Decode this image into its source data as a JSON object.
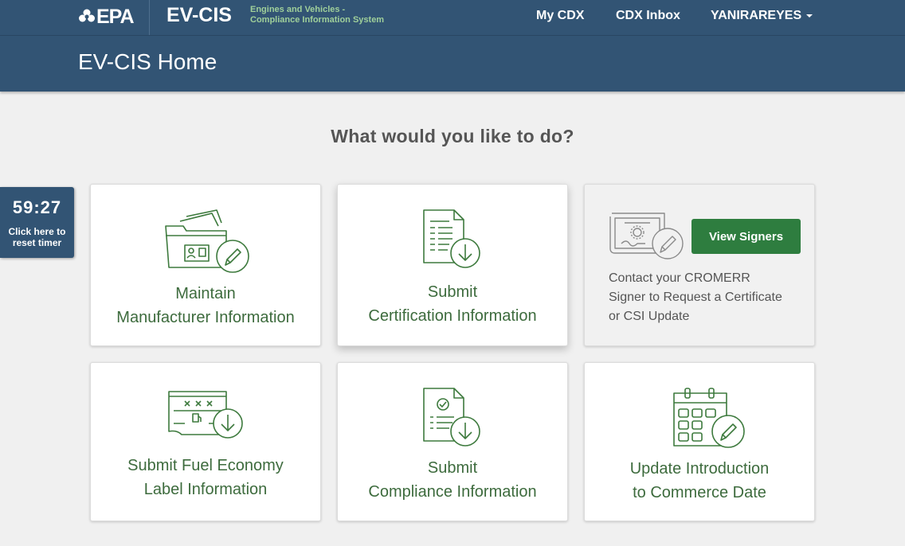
{
  "header": {
    "logo_text": "EPA",
    "brand": "EV-CIS",
    "brand_subtitle_line1": "Engines and Vehicles -",
    "brand_subtitle_line2": "Compliance Information System",
    "nav": {
      "my_cdx": "My CDX",
      "cdx_inbox": "CDX Inbox",
      "user": "YANIRAREYES"
    }
  },
  "page_title": "EV-CIS Home",
  "question": "What would you like to do?",
  "timer": {
    "time": "59:27",
    "hint_line1": "Click here to",
    "hint_line2": "reset timer"
  },
  "cards": {
    "maintain": {
      "line1": "Maintain",
      "line2": "Manufacturer Information",
      "icon": "folder-edit-icon"
    },
    "certification": {
      "line1": "Submit",
      "line2": "Certification Information",
      "icon": "document-download-icon"
    },
    "signers": {
      "button": "View Signers",
      "text_line1": "Contact your CROMERR",
      "text_line2": "Signer to Request a Certificate",
      "text_line3": "or CSI Update",
      "icon": "certificate-edit-icon"
    },
    "fuel": {
      "line1": "Submit Fuel Economy",
      "line2": "Label Information",
      "icon": "fuel-label-download-icon"
    },
    "compliance": {
      "line1": "Submit",
      "line2": "Compliance Information",
      "icon": "checklist-download-icon"
    },
    "commerce": {
      "line1": "Update Introduction",
      "line2": "to Commerce Date",
      "icon": "calendar-edit-icon"
    }
  },
  "colors": {
    "header": "#325474",
    "accent_green": "#3d6b3d",
    "button_green": "#2e7d3f",
    "subtitle_green": "#9fcf9a"
  }
}
